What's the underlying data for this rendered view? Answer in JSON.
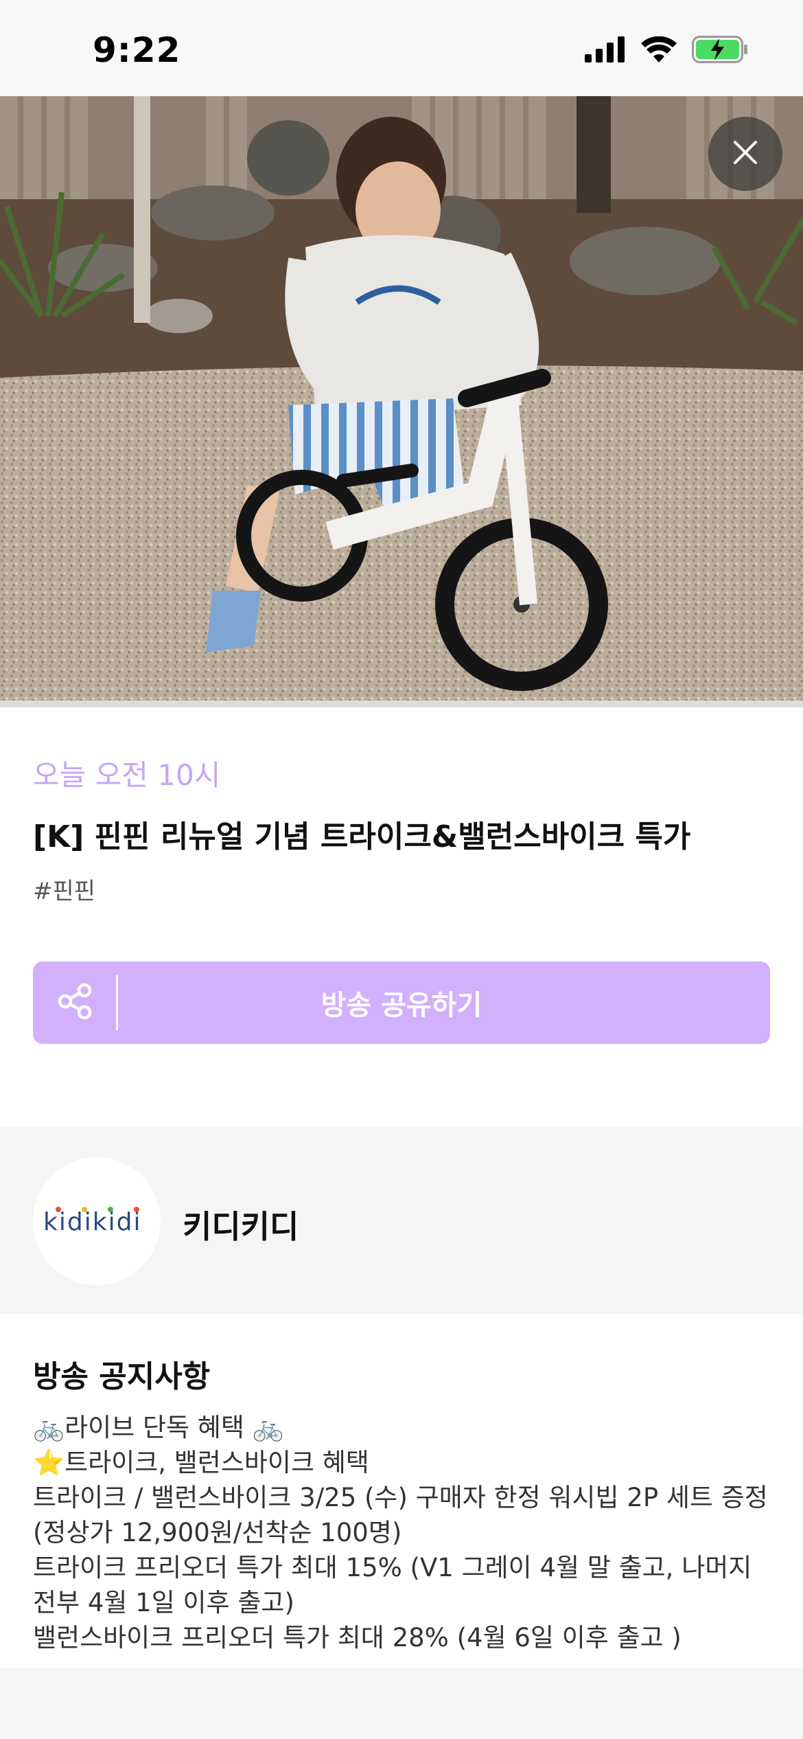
{
  "status_bar": {
    "time": "9:22",
    "icons": [
      "signal-icon",
      "wifi-icon",
      "battery-charging-icon"
    ]
  },
  "hero": {
    "close_icon": "close-icon",
    "bike_brand": "pinpin"
  },
  "broadcast": {
    "time": "오늘 오전 10시",
    "title": "[K] 핀핀 리뉴얼 기념 트라이크&밸런스바이크 특가",
    "tag": "#핀핀",
    "share_label": "방송 공유하기",
    "share_icon": "share-icon"
  },
  "seller": {
    "logo_text": "kidikidi",
    "name": "키디키디"
  },
  "notice": {
    "title": "방송 공지사항",
    "lines": [
      "🚲라이브 단독 혜택 🚲",
      "⭐트라이크, 밸런스바이크 혜택",
      "트라이크 / 밸런스바이크 3/25 (수) 구매자 한정 워시빕 2P 세트 증정 (정상가 12,900원/선착순 100명)",
      "트라이크 프리오더 특가 최대 15% (V1 그레이 4월 말 출고, 나머지 전부 4월 1일 이후 출고)",
      "밸런스바이크 프리오더 특가 최대 28% (4월 6일 이후 출고 )"
    ]
  },
  "colors": {
    "accent_purple": "#d2b0fb",
    "time_purple": "#c4a6f4",
    "battery_green": "#4cd964"
  }
}
